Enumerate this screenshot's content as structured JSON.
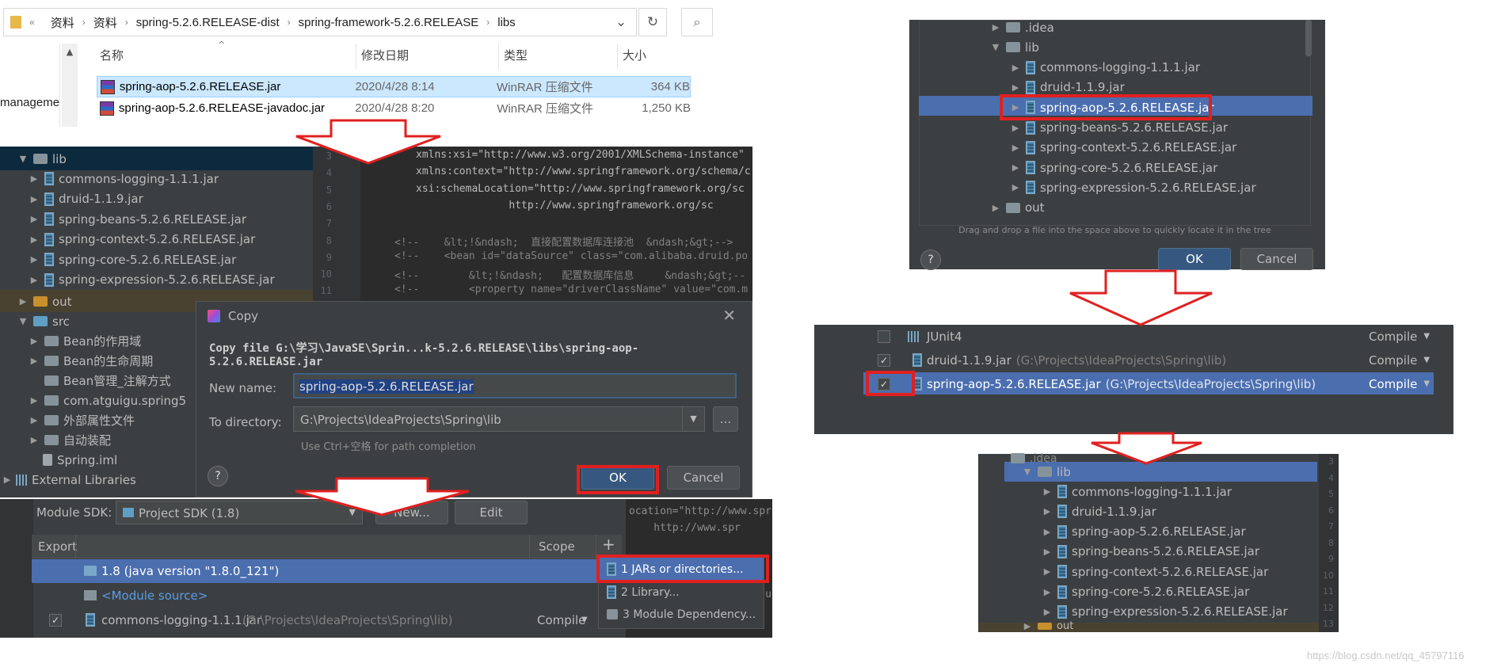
{
  "explorer": {
    "breadcrumb_prefix": "«",
    "breadcrumb": [
      "资料",
      "资料",
      "spring-5.2.6.RELEASE-dist",
      "spring-framework-5.2.6.RELEASE",
      "libs"
    ],
    "side_label": "manageme",
    "columns": [
      "名称",
      "修改日期",
      "类型",
      "大小"
    ],
    "rows": [
      {
        "name": "spring-aop-5.2.6.RELEASE.jar",
        "date": "2020/4/28 8:14",
        "type": "WinRAR 压缩文件",
        "size": "364 KB"
      },
      {
        "name": "spring-aop-5.2.6.RELEASE-javadoc.jar",
        "date": "2020/4/28 8:20",
        "type": "WinRAR 压缩文件",
        "size": "1,250 KB"
      }
    ]
  },
  "project_tree": {
    "lib_label": "lib",
    "lib_items": [
      "commons-logging-1.1.1.jar",
      "druid-1.1.9.jar",
      "spring-beans-5.2.6.RELEASE.jar",
      "spring-context-5.2.6.RELEASE.jar",
      "spring-core-5.2.6.RELEASE.jar",
      "spring-expression-5.2.6.RELEASE.jar"
    ],
    "out_label": "out",
    "src_label": "src",
    "src_items": [
      "Bean的作用域",
      "Bean的生命周期",
      "Bean管理_注解方式",
      "com.atguigu.spring5",
      "外部属性文件",
      "自动装配"
    ],
    "iml": "Spring.iml",
    "external": "External Libraries"
  },
  "editor": {
    "line_numbers": [
      "3",
      "4",
      "5",
      "6",
      "7",
      "8",
      "9",
      "10",
      "11"
    ],
    "lines": [
      "xmlns:xsi=\"http://www.w3.org/2001/XMLSchema-instance\"",
      "xmlns:context=\"http://www.springframework.org/schema/c",
      "xsi:schemaLocation=\"http://www.springframework.org/sc",
      "               http://www.springframework.org/sc",
      "",
      "<!--    &lt;!&ndash;  直接配置数据库连接池  &ndash;&gt;-->",
      "<!--    <bean id=\"dataSource\" class=\"com.alibaba.druid.po",
      "<!--        &lt;!&ndash;   配置数据库信息     &ndash;&gt;--",
      "<!--        <property name=\"driverClassName\" value=\"com.m"
    ]
  },
  "copy_dialog": {
    "title": "Copy",
    "message": "Copy file G:\\学习\\JavaSE\\Sprin...k-5.2.6.RELEASE\\libs\\spring-aop-5.2.6.RELEASE.jar",
    "new_name_label": "New name:",
    "new_name_value": "spring-aop-5.2.6.RELEASE.jar",
    "dir_label": "To directory:",
    "dir_value": "G:\\Projects\\IdeaProjects\\Spring\\lib",
    "browse": "...",
    "hint": "Use Ctrl+空格 for path completion",
    "ok": "OK",
    "cancel": "Cancel",
    "help": "?"
  },
  "module_deps": {
    "sdk_label": "Module SDK:",
    "sdk_value": "Project SDK (1.8)",
    "new_btn": "New...",
    "edit_btn": "Edit",
    "export_col": "Export",
    "scope_col": "Scope",
    "add": "+",
    "rows": [
      {
        "name": "1.8 (java version \"1.8.0_121\")",
        "path": ""
      },
      {
        "name": "<Module source>",
        "path": ""
      },
      {
        "name": "commons-logging-1.1.1.jar",
        "path": "(G:\\Projects\\IdeaProjects\\Spring\\lib)",
        "scope": "Compile"
      }
    ],
    "popup": [
      "1  JARs or directories...",
      "2  Library...",
      "3  Module Dependency..."
    ],
    "code_right": [
      "ocation=\"http://www.spr",
      "    http://www.spr",
      "",
      "",
      "",
      "roperty name=\"url\" valu"
    ]
  },
  "chooser": {
    "items": [
      ".idea",
      "lib",
      "commons-logging-1.1.1.jar",
      "druid-1.1.9.jar",
      "spring-aop-5.2.6.RELEASE.jar",
      "spring-beans-5.2.6.RELEASE.jar",
      "spring-context-5.2.6.RELEASE.jar",
      "spring-core-5.2.6.RELEASE.jar",
      "spring-expression-5.2.6.RELEASE.jar",
      "out"
    ],
    "hint": "Drag and drop a file into the space above to quickly locate it in the tree",
    "ok": "OK",
    "cancel": "Cancel",
    "help": "?"
  },
  "deps_result": {
    "rows": [
      {
        "name": "JUnit4",
        "path": "",
        "scope": "Compile",
        "checked": false
      },
      {
        "name": "druid-1.1.9.jar",
        "path": "(G:\\Projects\\IdeaProjects\\Spring\\lib)",
        "scope": "Compile",
        "checked": true
      },
      {
        "name": "spring-aop-5.2.6.RELEASE.jar",
        "path": "(G:\\Projects\\IdeaProjects\\Spring\\lib)",
        "scope": "Compile",
        "checked": true
      }
    ]
  },
  "final_tree": {
    "top_label": ".idea",
    "lib_label": "lib",
    "items": [
      "commons-logging-1.1.1.jar",
      "druid-1.1.9.jar",
      "spring-aop-5.2.6.RELEASE.jar",
      "spring-beans-5.2.6.RELEASE.jar",
      "spring-context-5.2.6.RELEASE.jar",
      "spring-core-5.2.6.RELEASE.jar",
      "spring-expression-5.2.6.RELEASE.jar"
    ],
    "out_label": "out",
    "gutter": [
      "3",
      "4",
      "5",
      "6",
      "7",
      "8",
      "9",
      "10",
      "11",
      "12",
      "13"
    ]
  },
  "watermark": "https://blog.csdn.net/qq_45797116",
  "colors": {
    "highlight": "#e02020",
    "selection": "#4b6eaf",
    "accent": "#365880"
  }
}
